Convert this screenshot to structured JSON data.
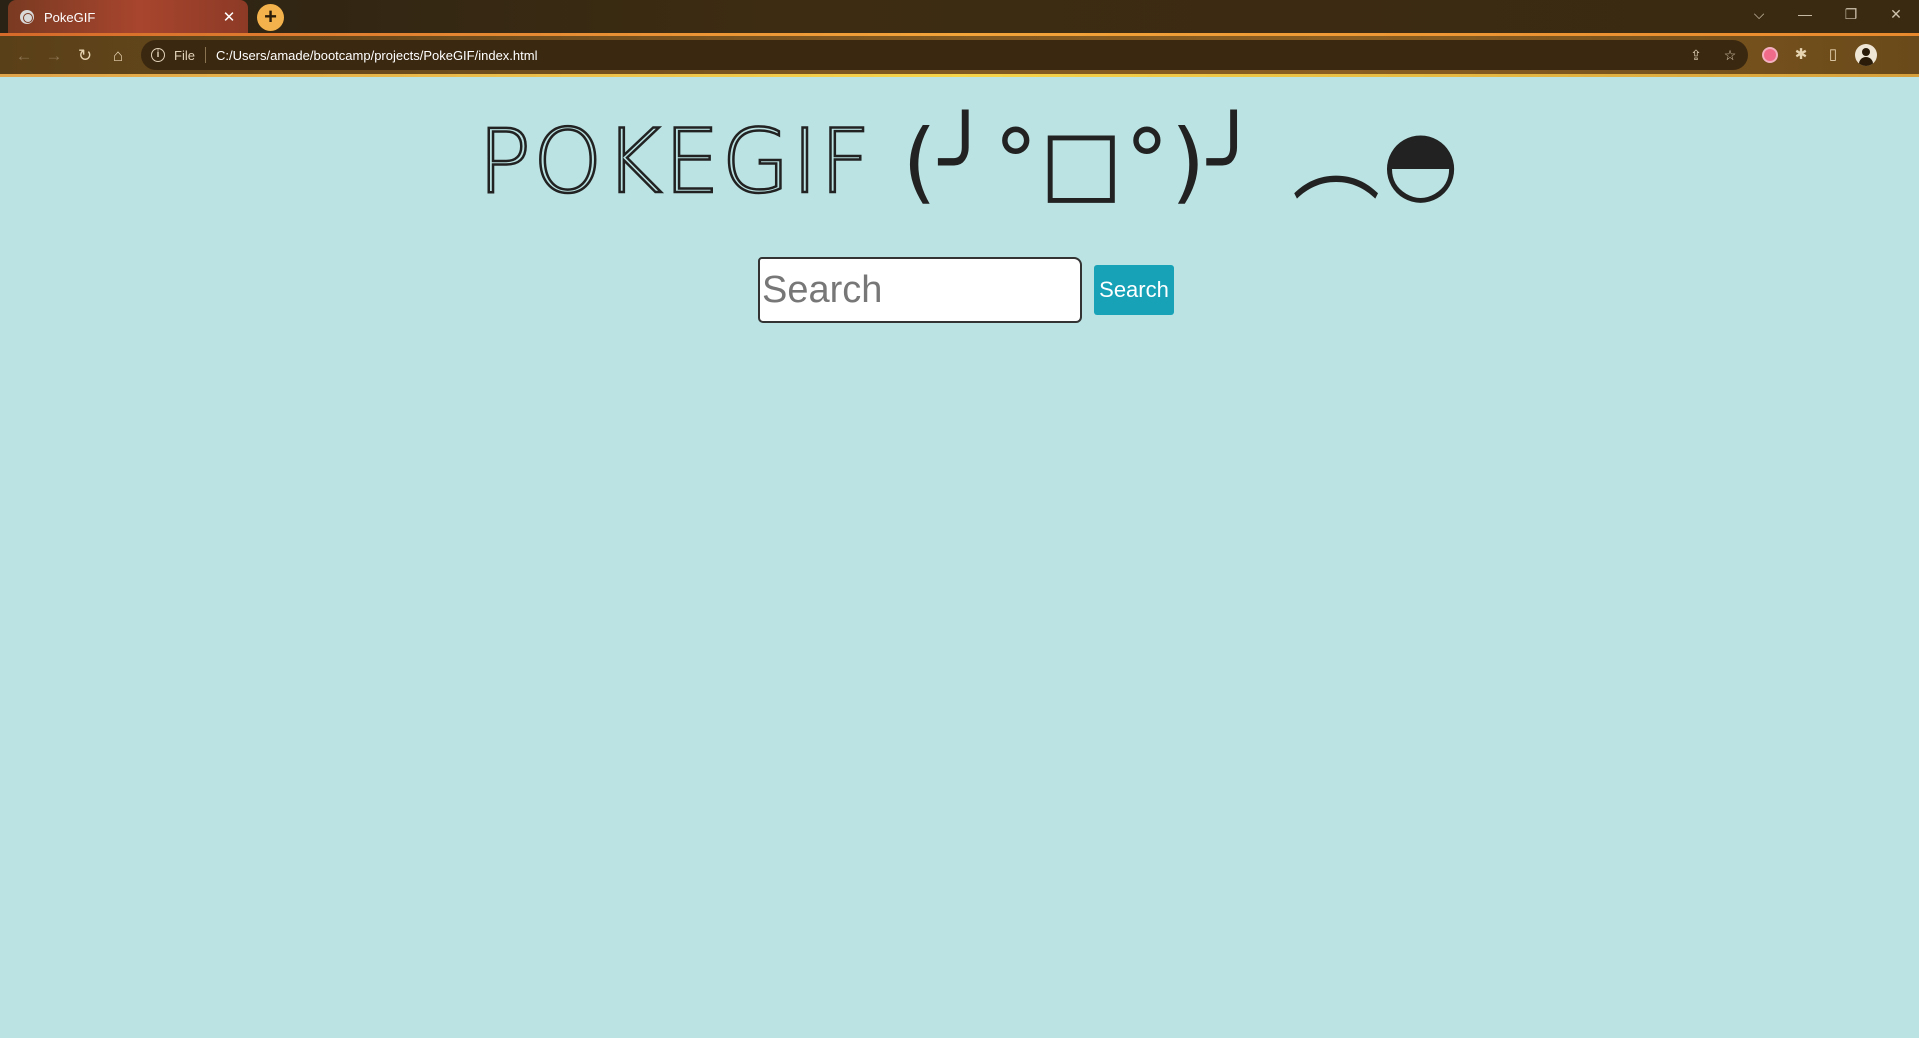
{
  "browser": {
    "tab_title": "PokeGIF",
    "tab_close": "✕",
    "new_tab": "+",
    "address_scheme": "File",
    "address_url": "C:/Users/amade/bootcamp/projects/PokeGIF/index.html",
    "window_controls": {
      "dropdown": "⌵",
      "minimize": "—",
      "restore": "❐",
      "close": "✕"
    },
    "nav": {
      "back": "←",
      "forward": "→",
      "reload": "↻",
      "home": "⌂"
    }
  },
  "page": {
    "title": "POKEGIF",
    "title_face": "(╯°□°)╯ ︵◓",
    "search": {
      "placeholder": "Search",
      "value": "",
      "button_label": "Search"
    }
  },
  "colors": {
    "page_background": "#bbe3e3",
    "button_background": "#17a2b8"
  }
}
